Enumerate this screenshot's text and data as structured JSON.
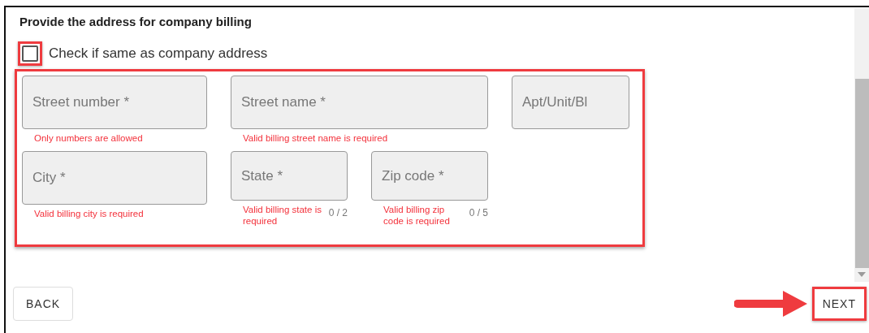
{
  "heading": "Provide the address for company billing",
  "same_address": {
    "label": "Check if same as company address",
    "checked": false
  },
  "field_rows": [
    [
      {
        "placeholder": "Street number *",
        "error": "Only numbers are allowed"
      },
      {
        "placeholder": "Street name *",
        "error": "Valid billing street name is required"
      },
      {
        "placeholder": "Apt/Unit/Bl"
      }
    ],
    [
      {
        "placeholder": "City *",
        "error": "Valid billing city is required"
      },
      {
        "placeholder": "State *",
        "error": "Valid billing state is required",
        "counter": "0 / 2"
      },
      {
        "placeholder": "Zip code *",
        "error": "Valid billing zip code is required",
        "counter": "0 / 5"
      }
    ]
  ],
  "buttons": {
    "back": "BACK",
    "next": "NEXT"
  }
}
